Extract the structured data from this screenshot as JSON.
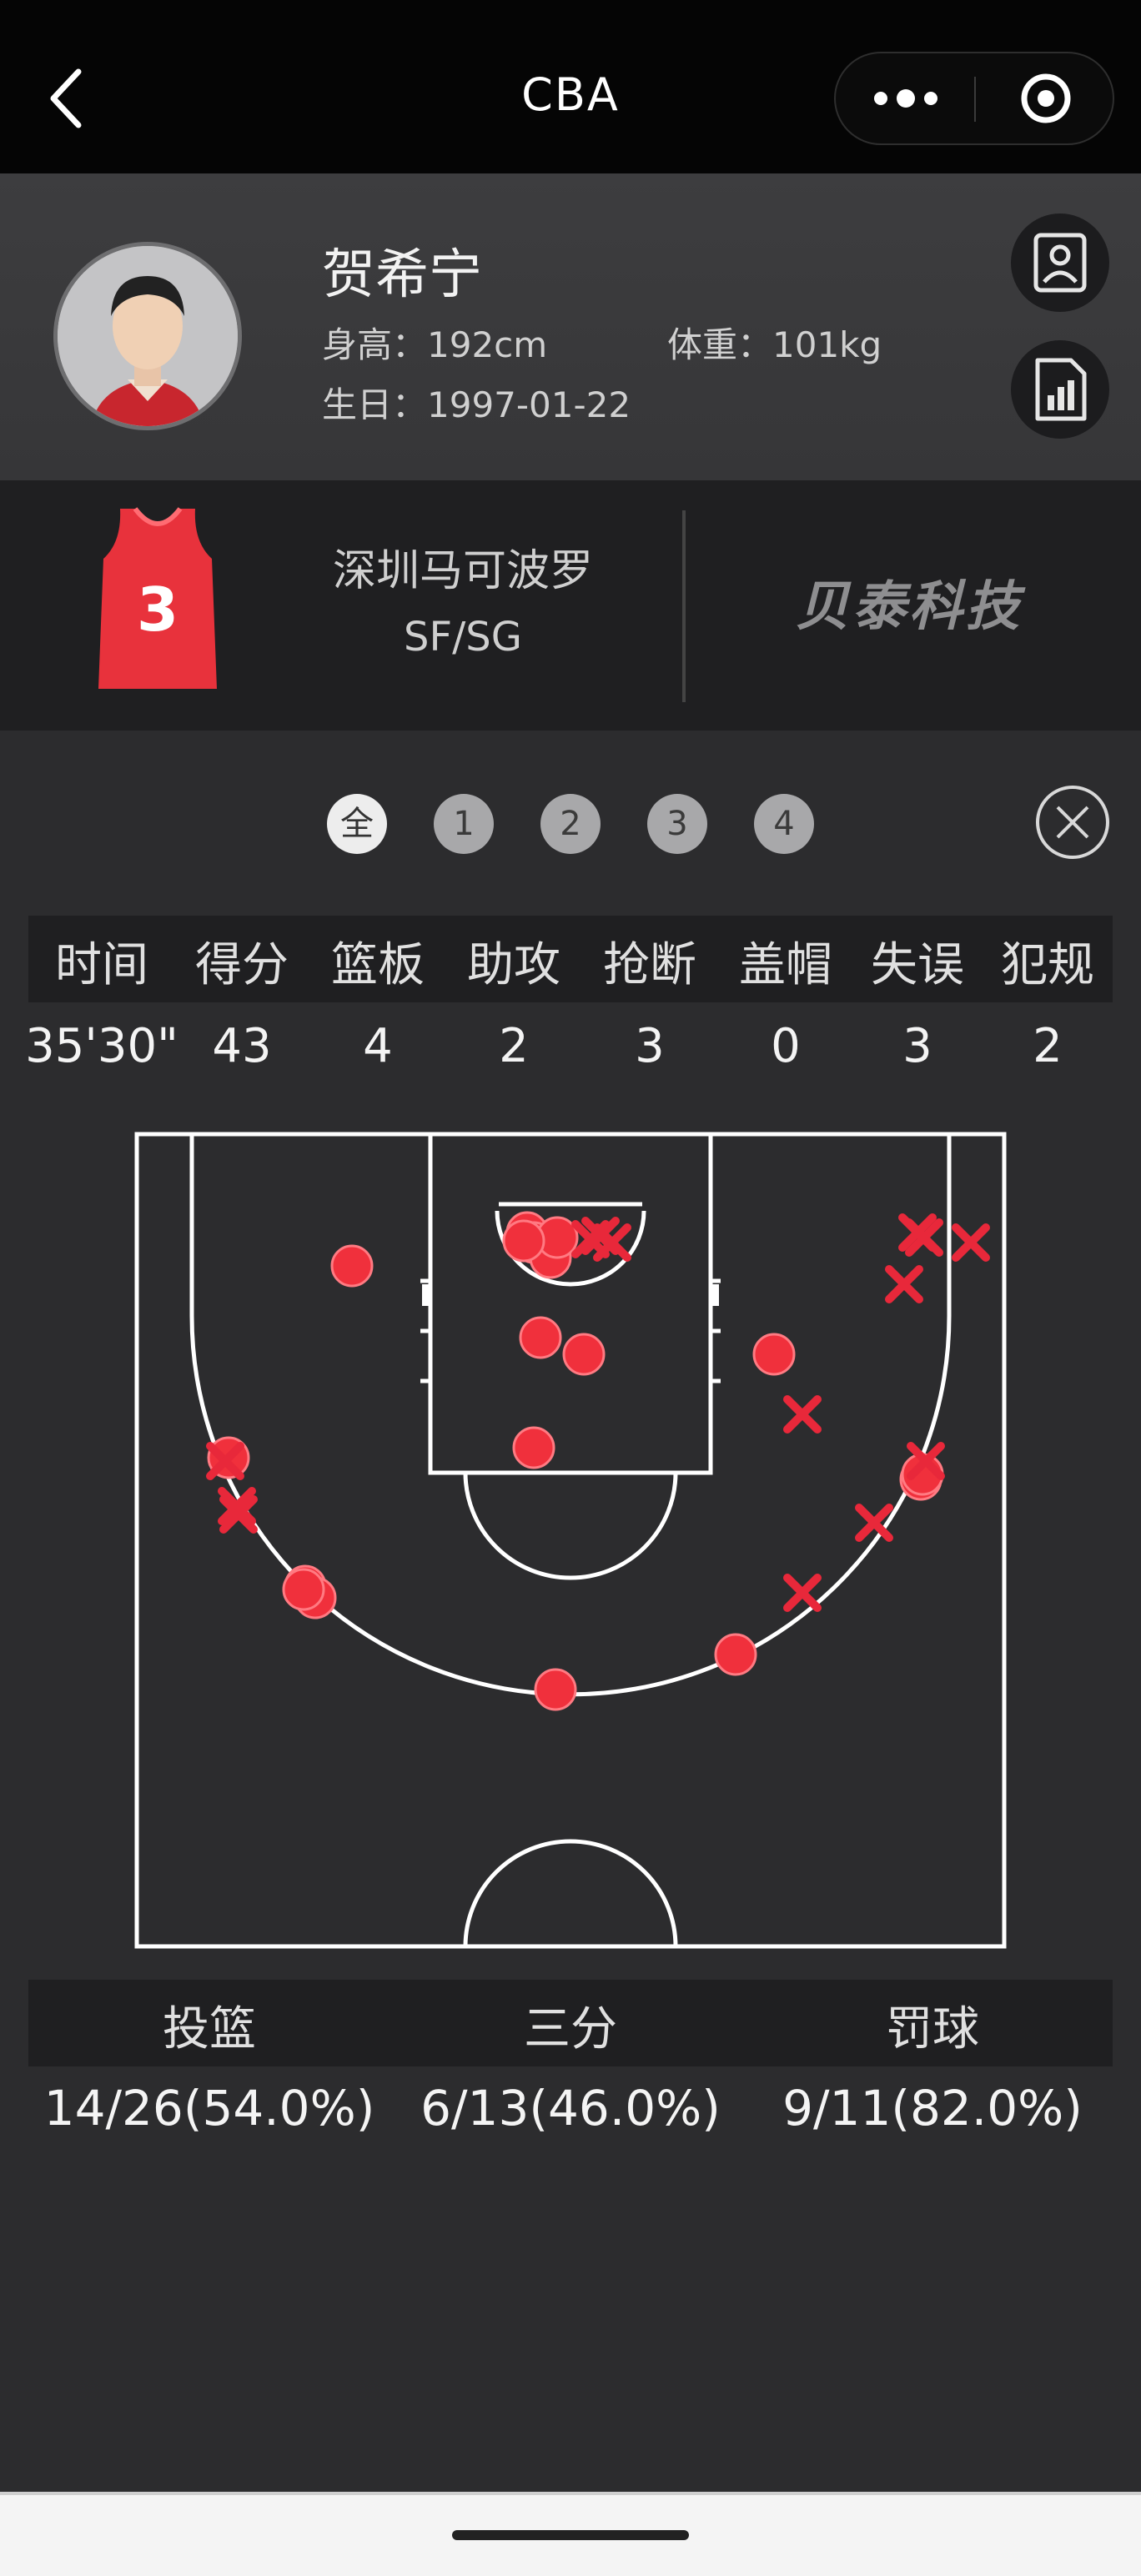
{
  "nav": {
    "title": "CBA",
    "back_icon": "chevron-left-icon",
    "more_icon": "more-dots-icon",
    "close_icon": "target-circle-icon"
  },
  "player": {
    "name": "贺希宁",
    "height": "身高：192cm",
    "weight": "体重：101kg",
    "birthday": "生日：1997-01-22",
    "profile_icon": "person-card-icon",
    "report_icon": "bar-chart-document-icon"
  },
  "team": {
    "name": "深圳马可波罗",
    "position": "SF/SG",
    "jersey_number": "3",
    "jersey_color": "#e8323c",
    "sponsor": "贝泰科技"
  },
  "quarter_tabs": {
    "all": "全",
    "q1": "1",
    "q2": "2",
    "q3": "3",
    "q4": "4",
    "selected": "全"
  },
  "stats": {
    "headers": [
      "时间",
      "得分",
      "篮板",
      "助攻",
      "抢断",
      "盖帽",
      "失误",
      "犯规"
    ],
    "values": [
      "35'30\"",
      "43",
      "4",
      "2",
      "3",
      "0",
      "3",
      "2"
    ]
  },
  "shot_chart": {
    "made_color": "#f0303c",
    "missed_color": "#e8283a",
    "made_shots": 19,
    "missed_shots": 14
  },
  "shooting": {
    "headers": [
      "投篮",
      "三分",
      "罚球"
    ],
    "values": [
      "14/26(54.0%)",
      "6/13(46.0%)",
      "9/11(82.0%)"
    ]
  },
  "colors": {
    "background": "#2c2c2e",
    "topbar": "#050505",
    "accent_red": "#f0303c"
  }
}
